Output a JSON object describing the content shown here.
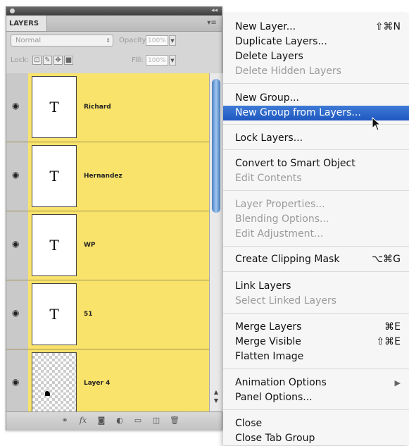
{
  "panel": {
    "tab_label": "LAYERS",
    "blend_mode": "Normal",
    "opacity_label": "Opacity:",
    "opacity_value": "100%",
    "lock_label": "Lock:",
    "fill_label": "Fill:",
    "fill_value": "100%",
    "layers": [
      {
        "name": "Richard",
        "thumb_text": "T",
        "visible": true,
        "highlight": "#f9e36b"
      },
      {
        "name": "Hernandez",
        "thumb_text": "T",
        "visible": true,
        "highlight": "#f9e36b"
      },
      {
        "name": "WP",
        "thumb_text": "T",
        "visible": true,
        "highlight": "#f9e36b"
      },
      {
        "name": "51",
        "thumb_text": "T",
        "visible": true,
        "highlight": "#f9e36b"
      },
      {
        "name": "Layer 4",
        "thumb_text": "",
        "visible": true,
        "highlight": "#f9e36b"
      }
    ],
    "bottom_icons": [
      "link-icon",
      "fx-icon",
      "mask-icon",
      "adjustment-icon",
      "folder-icon",
      "new-layer-icon",
      "trash-icon"
    ],
    "bottom_glyphs": {
      "link": "⚭",
      "fx": "fx",
      "mask": "◙",
      "adjustment": "◐",
      "folder": "▭",
      "new_layer": "◫",
      "trash": "🗑"
    }
  },
  "menu": {
    "items": [
      {
        "label": "New Layer...",
        "shortcut": "⇧⌘N",
        "disabled": false
      },
      {
        "label": "Duplicate Layers...",
        "shortcut": "",
        "disabled": false
      },
      {
        "label": "Delete Layers",
        "shortcut": "",
        "disabled": false
      },
      {
        "label": "Delete Hidden Layers",
        "shortcut": "",
        "disabled": true
      },
      {
        "label": "New Group...",
        "shortcut": "",
        "disabled": false
      },
      {
        "label": "New Group from Layers...",
        "shortcut": "",
        "disabled": false,
        "selected": true
      },
      {
        "label": "Lock Layers...",
        "shortcut": "",
        "disabled": false
      },
      {
        "label": "Convert to Smart Object",
        "shortcut": "",
        "disabled": false
      },
      {
        "label": "Edit Contents",
        "shortcut": "",
        "disabled": true
      },
      {
        "label": "Layer Properties...",
        "shortcut": "",
        "disabled": true
      },
      {
        "label": "Blending Options...",
        "shortcut": "",
        "disabled": true
      },
      {
        "label": "Edit Adjustment...",
        "shortcut": "",
        "disabled": true
      },
      {
        "label": "Create Clipping Mask",
        "shortcut": "⌥⌘G",
        "disabled": false
      },
      {
        "label": "Link Layers",
        "shortcut": "",
        "disabled": false
      },
      {
        "label": "Select Linked Layers",
        "shortcut": "",
        "disabled": true
      },
      {
        "label": "Merge Layers",
        "shortcut": "⌘E",
        "disabled": false
      },
      {
        "label": "Merge Visible",
        "shortcut": "⇧⌘E",
        "disabled": false
      },
      {
        "label": "Flatten Image",
        "shortcut": "",
        "disabled": false
      },
      {
        "label": "Animation Options",
        "shortcut": "▶",
        "disabled": false
      },
      {
        "label": "Panel Options...",
        "shortcut": "",
        "disabled": false
      },
      {
        "label": "Close",
        "shortcut": "",
        "disabled": false
      },
      {
        "label": "Close Tab Group",
        "shortcut": "",
        "disabled": false
      }
    ],
    "selected_color": "#2a64c8"
  }
}
